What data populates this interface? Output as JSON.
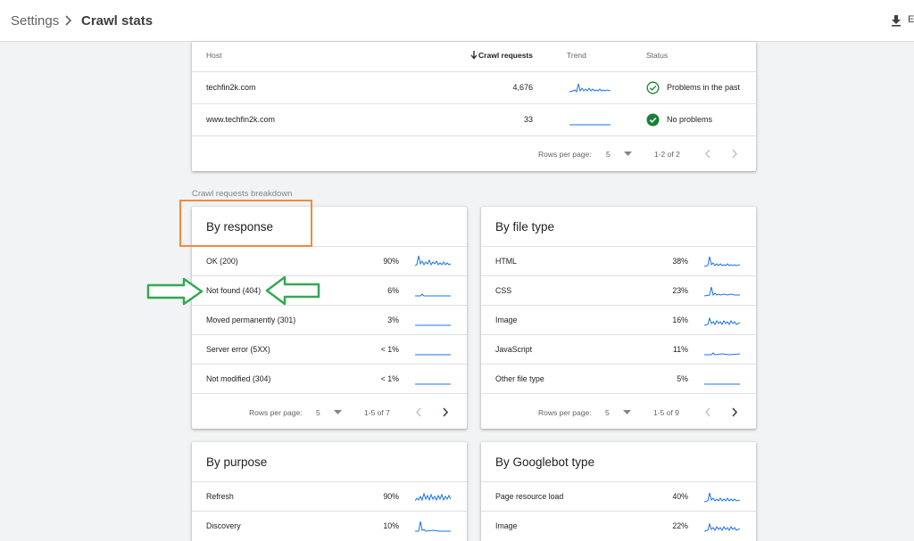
{
  "header": {
    "breadcrumb_root": "Settings",
    "title": "Crawl stats",
    "export_label": "E"
  },
  "hosts_table": {
    "columns": {
      "host": "Host",
      "requests": "Crawl requests",
      "trend": "Trend",
      "status": "Status"
    },
    "rows": [
      {
        "host": "techfin2k.com",
        "requests": "4,676",
        "status": "Problems in the past",
        "status_type": "past"
      },
      {
        "host": "www.techfin2k.com",
        "requests": "33",
        "status": "No problems",
        "status_type": "ok"
      }
    ],
    "rows_per_page_label": "Rows per page:",
    "rows_per_page": "5",
    "range": "1-2 of 2"
  },
  "breakdown_label": "Crawl requests breakdown",
  "cards": {
    "response": {
      "title": "By response",
      "rows": [
        {
          "label": "OK (200)",
          "pct": "90%"
        },
        {
          "label": "Not found (404)",
          "pct": "6%"
        },
        {
          "label": "Moved permanently (301)",
          "pct": "3%"
        },
        {
          "label": "Server error (5XX)",
          "pct": "< 1%"
        },
        {
          "label": "Not modified (304)",
          "pct": "< 1%"
        }
      ],
      "rows_per_page_label": "Rows per page:",
      "rows_per_page": "5",
      "range": "1-5 of 7"
    },
    "filetype": {
      "title": "By file type",
      "rows": [
        {
          "label": "HTML",
          "pct": "38%"
        },
        {
          "label": "CSS",
          "pct": "23%"
        },
        {
          "label": "Image",
          "pct": "16%"
        },
        {
          "label": "JavaScript",
          "pct": "11%"
        },
        {
          "label": "Other file type",
          "pct": "5%"
        }
      ],
      "rows_per_page_label": "Rows per page:",
      "rows_per_page": "5",
      "range": "1-5 of 9"
    },
    "purpose": {
      "title": "By purpose",
      "rows": [
        {
          "label": "Refresh",
          "pct": "90%"
        },
        {
          "label": "Discovery",
          "pct": "10%"
        }
      ]
    },
    "googlebot": {
      "title": "By Googlebot type",
      "rows": [
        {
          "label": "Page resource load",
          "pct": "40%"
        },
        {
          "label": "Image",
          "pct": "22%"
        }
      ]
    }
  },
  "colors": {
    "sparkline": "#1a73e8",
    "status_ok": "#188038",
    "annotation_box": "#f08a3c",
    "annotation_arrows": "#34a853"
  }
}
